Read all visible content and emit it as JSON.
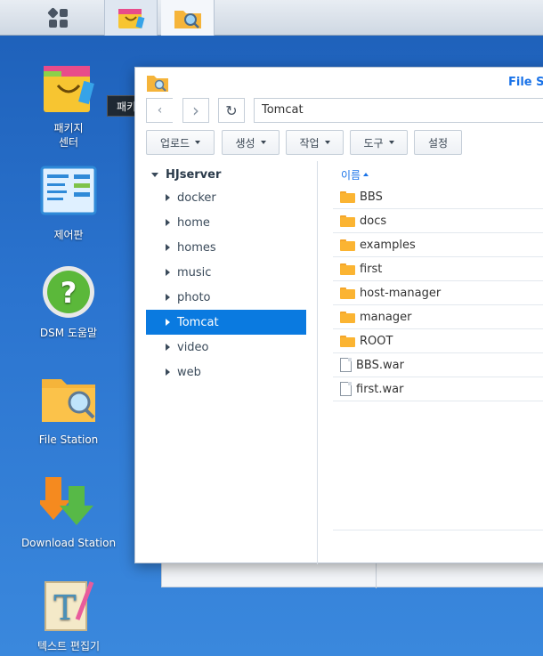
{
  "taskbar": {
    "buttons": [
      {
        "name": "main-menu",
        "icon": "grid-icon"
      },
      {
        "name": "package-center",
        "icon": "shopping-bag-icon"
      },
      {
        "name": "file-station",
        "icon": "folder-search-icon"
      }
    ]
  },
  "desktop": {
    "icons": [
      {
        "label": "패키지\n센터",
        "icon": "shopping-bag-icon"
      },
      {
        "label": "제어판",
        "icon": "control-panel-icon"
      },
      {
        "label": "DSM 도움말",
        "icon": "help-icon"
      },
      {
        "label": "File Station",
        "icon": "folder-search-icon"
      },
      {
        "label": "Download Station",
        "icon": "download-arrows-icon"
      },
      {
        "label": "텍스트 편집기",
        "icon": "text-editor-icon"
      }
    ],
    "tooltip": "패키지 센터"
  },
  "window": {
    "title": "File S",
    "path": "Tomcat",
    "toolbar": [
      "업로드",
      "생성",
      "작업",
      "도구",
      "설정"
    ],
    "tree": {
      "root": "HJserver",
      "items": [
        "docker",
        "home",
        "homes",
        "music",
        "photo",
        "Tomcat",
        "video",
        "web"
      ],
      "selected": "Tomcat"
    },
    "list": {
      "header": "이름",
      "rows": [
        {
          "name": "BBS",
          "type": "folder"
        },
        {
          "name": "docs",
          "type": "folder"
        },
        {
          "name": "examples",
          "type": "folder"
        },
        {
          "name": "first",
          "type": "folder"
        },
        {
          "name": "host-manager",
          "type": "folder"
        },
        {
          "name": "manager",
          "type": "folder"
        },
        {
          "name": "ROOT",
          "type": "folder"
        },
        {
          "name": "BBS.war",
          "type": "file"
        },
        {
          "name": "first.war",
          "type": "file"
        }
      ]
    }
  },
  "colors": {
    "accent": "#0a7ae0",
    "desktop": "#2b74cf"
  }
}
